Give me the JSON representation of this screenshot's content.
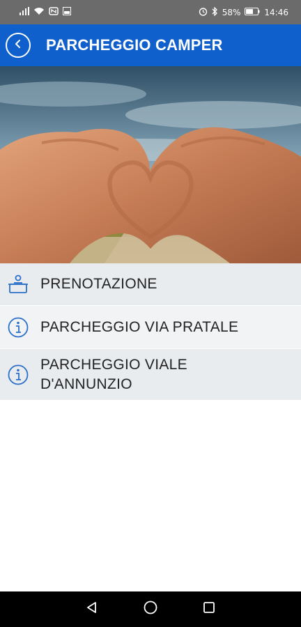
{
  "status_bar": {
    "battery": "58%",
    "time": "14:46",
    "icons": [
      "signal-icon",
      "wifi-icon",
      "nfc-icon",
      "image-icon",
      "alarm-icon",
      "bluetooth-icon",
      "battery-icon"
    ]
  },
  "header": {
    "title": "PARCHEGGIO CAMPER",
    "back_icon": "back-arrow-icon",
    "color": "#0f5fcc"
  },
  "hero": {
    "description_icon": "heart-hands-camper-image"
  },
  "menu": {
    "items": [
      {
        "label": "PRENOTAZIONE",
        "icon": "reception-desk-icon"
      },
      {
        "label": "PARCHEGGIO VIA PRATALE",
        "icon": "info-icon"
      },
      {
        "label_line1": "PARCHEGGIO VIALE",
        "label_line2": "D'ANNUNZIO",
        "icon": "info-icon"
      }
    ]
  },
  "nav_bar": {
    "icons": [
      "back-triangle-icon",
      "home-circle-icon",
      "recents-square-icon"
    ]
  }
}
